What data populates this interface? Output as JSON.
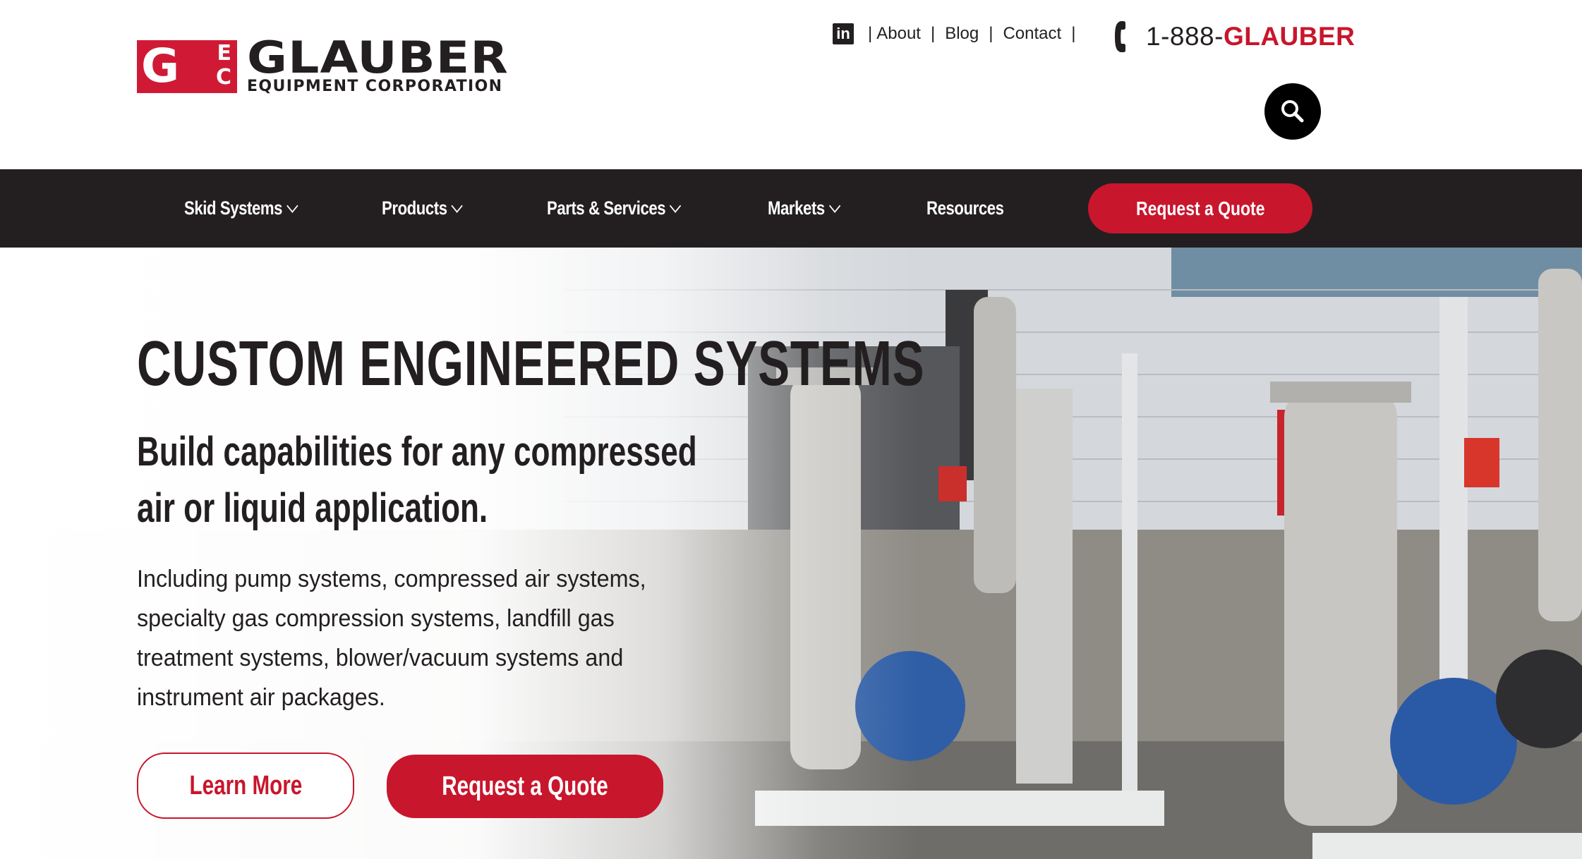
{
  "brand": {
    "logo_mark_letters": {
      "g": "G",
      "e": "E",
      "c": "C"
    },
    "name": "GLAUBER",
    "subtitle": "EQUIPMENT CORPORATION",
    "colors": {
      "red": "#c8162c",
      "dark": "#231f20",
      "white": "#ffffff"
    }
  },
  "utility_nav": {
    "social_icon": "linkedin-icon",
    "social_label": "in",
    "separator": "|",
    "links": [
      "About",
      "Blog",
      "Contact"
    ],
    "phone_icon": "phone-icon",
    "phone_prefix": "1-888-",
    "phone_word": "GLAUBER",
    "search_icon": "search-icon"
  },
  "main_nav": {
    "items": [
      {
        "label": "Skid Systems",
        "has_dropdown": true
      },
      {
        "label": "Products",
        "has_dropdown": true
      },
      {
        "label": "Parts & Services",
        "has_dropdown": true
      },
      {
        "label": "Markets",
        "has_dropdown": true
      },
      {
        "label": "Resources",
        "has_dropdown": false
      }
    ],
    "cta_label": "Request a Quote"
  },
  "hero": {
    "title": "CUSTOM ENGINEERED SYSTEMS",
    "subtitle": "Build capabilities for any compressed air or liquid application.",
    "body": "Including pump systems, compressed air systems, specialty gas compression systems, landfill gas treatment systems, blower/vacuum systems and instrument air packages.",
    "learn_more_label": "Learn More",
    "quote_label": "Request a Quote",
    "background_image": "skid-systems-photo"
  }
}
